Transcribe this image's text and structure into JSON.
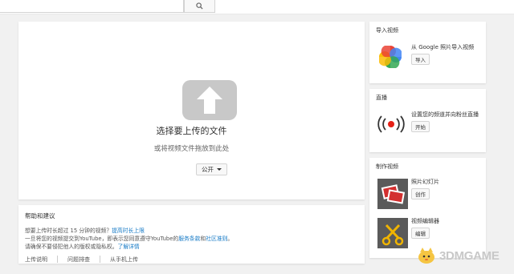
{
  "search": {
    "placeholder": ""
  },
  "upload": {
    "title": "选择要上传的文件",
    "subtitle": "或将视频文件拖放到此处",
    "privacy_label": "公开"
  },
  "help": {
    "title": "帮助和建议",
    "line1_text": "想要上传时长超过 15 分钟的视频？",
    "line1_link": "提高时长上限",
    "line2_text": "一旦将您的视频提交到YouTube，即表示您同意遵守YouTube的",
    "line2_link1": "服务条款",
    "line2_mid": "和",
    "line2_link2": "社区准则",
    "line2_end": "。",
    "line3_text": "请确保不要侵犯他人的版权或隐私权。",
    "line3_link": "了解详情",
    "links": [
      "上传说明",
      "问题排查",
      "从手机上传"
    ]
  },
  "import": {
    "title": "导入视频",
    "text": "从 Google 照片导入视频",
    "button": "导入"
  },
  "live": {
    "title": "直播",
    "text": "设置您的频道并向粉丝直播",
    "button": "开始"
  },
  "create": {
    "title": "制作视频",
    "items": [
      {
        "text": "照片幻灯片",
        "button": "创作"
      },
      {
        "text": "视频编辑器",
        "button": "编辑"
      }
    ]
  },
  "watermark": {
    "text": "3DMGAME"
  },
  "colors": {
    "link": "#167ac6",
    "upload_icon": "#c8c8c8",
    "live_red": "#e62117"
  }
}
